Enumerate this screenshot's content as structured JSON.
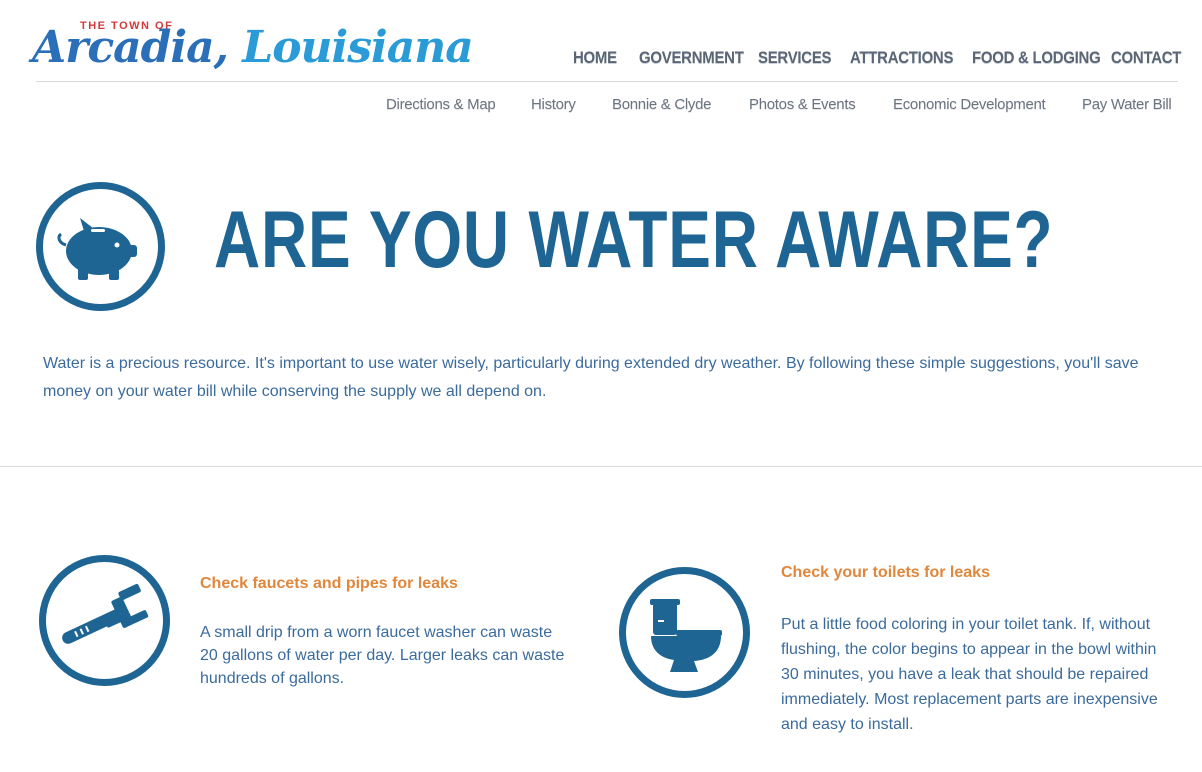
{
  "logo": {
    "small_text": "THE TOWN OF",
    "name_part1": "Arcadia,",
    "name_part2": " Louisiana"
  },
  "main_nav": [
    {
      "label": "HOME"
    },
    {
      "label": "GOVERNMENT"
    },
    {
      "label": "SERVICES"
    },
    {
      "label": "ATTRACTIONS"
    },
    {
      "label": "FOOD & LODGING"
    },
    {
      "label": "CONTACT"
    }
  ],
  "sub_nav": [
    {
      "label": "Directions & Map"
    },
    {
      "label": "History"
    },
    {
      "label": "Bonnie & Clyde"
    },
    {
      "label": "Photos & Events"
    },
    {
      "label": "Economic Development"
    },
    {
      "label": "Pay Water Bill"
    }
  ],
  "hero": {
    "icon": "piggy-bank-icon",
    "title": "ARE YOU WATER AWARE?"
  },
  "intro": "Water is a precious resource. It's important to use water wisely, particularly during extended dry weather. By following these simple suggestions, you'll save money on your water bill while conserving the supply we all depend on.",
  "tips": [
    {
      "icon": "wrench-icon",
      "title": "Check faucets and pipes for leaks",
      "body": "A small drip from a worn faucet washer can waste 20 gallons of water per day. Larger leaks can waste hundreds of gallons."
    },
    {
      "icon": "toilet-icon",
      "title": "Check your toilets for leaks",
      "body": "Put a little food coloring in your toilet tank. If, without flushing, the color begins to appear in the bowl within 30 minutes, you have a leak that should be repaired immediately. Most replacement parts are inexpensive and easy to install."
    }
  ],
  "colors": {
    "icon_blue": "#1e6594",
    "title_orange": "#e0873b",
    "text_blue": "#3b6b9c"
  }
}
